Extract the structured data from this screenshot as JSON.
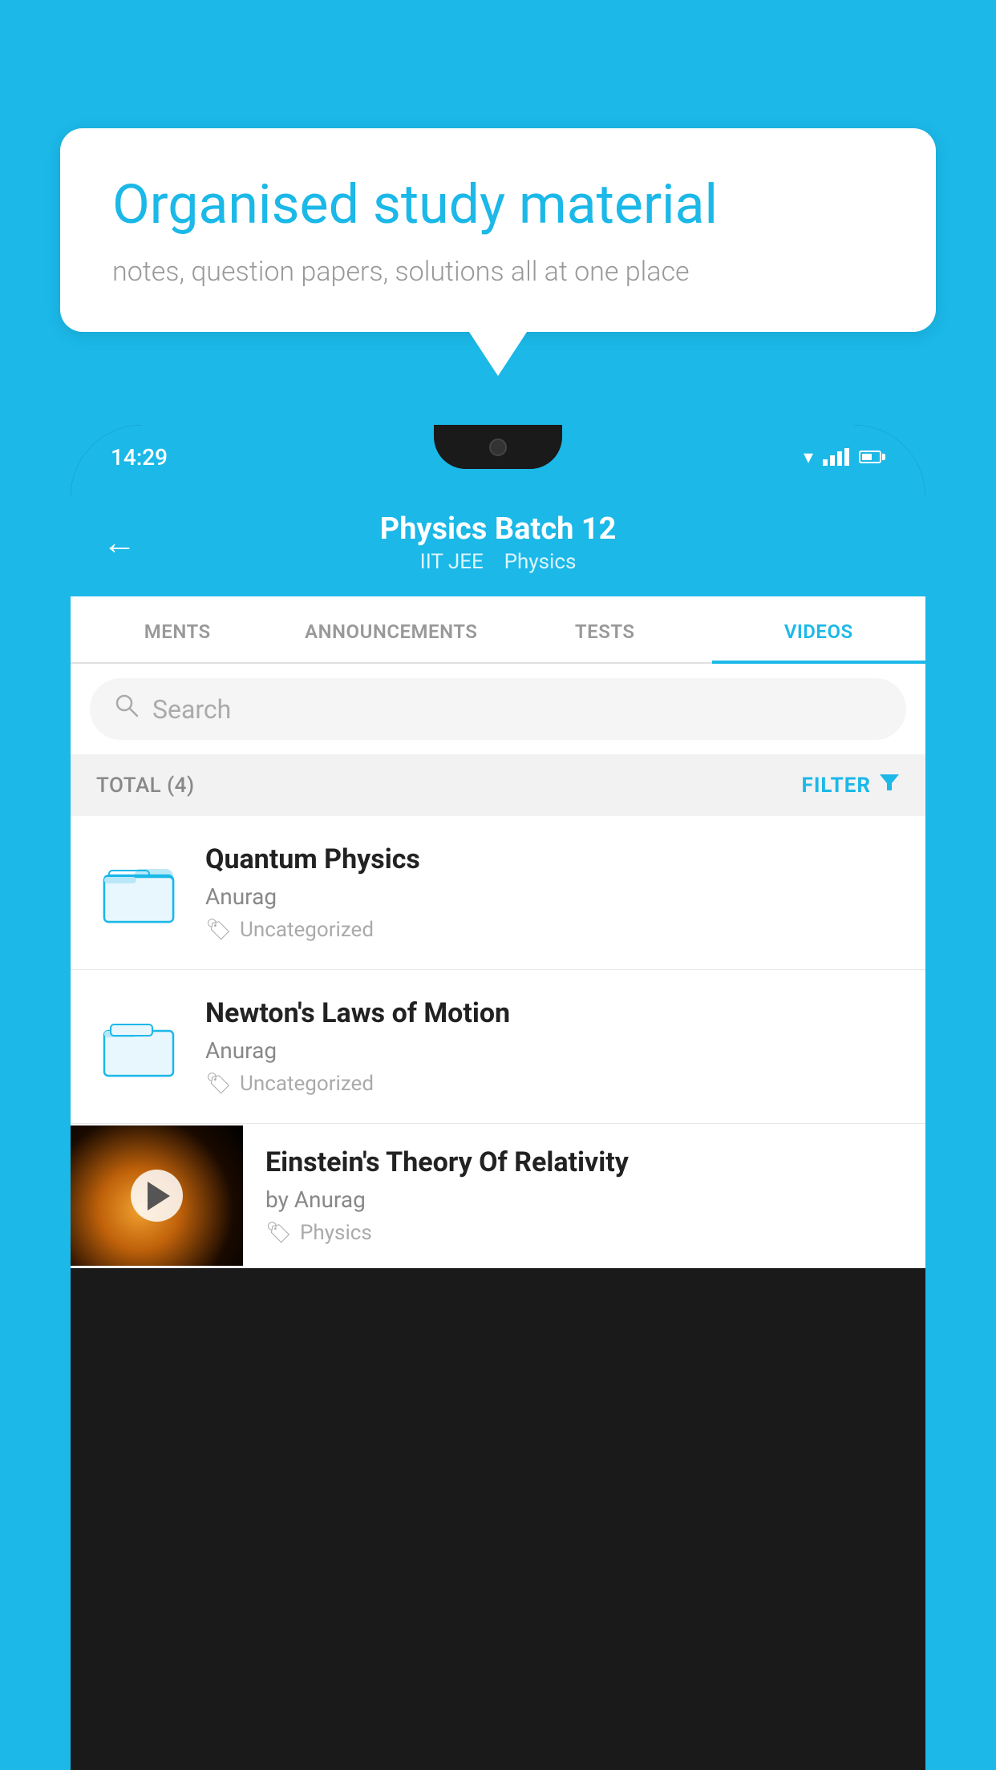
{
  "background_color": "#1BB8E8",
  "speech_bubble": {
    "title": "Organised study material",
    "subtitle": "notes, question papers, solutions all at one place"
  },
  "phone": {
    "status_bar": {
      "time": "14:29"
    },
    "header": {
      "title": "Physics Batch 12",
      "subtitle_part1": "IIT JEE",
      "subtitle_part2": "Physics",
      "back_label": "←"
    },
    "tabs": [
      {
        "label": "MENTS",
        "active": false
      },
      {
        "label": "ANNOUNCEMENTS",
        "active": false
      },
      {
        "label": "TESTS",
        "active": false
      },
      {
        "label": "VIDEOS",
        "active": true
      }
    ],
    "search": {
      "placeholder": "Search"
    },
    "filter_row": {
      "total_label": "TOTAL (4)",
      "filter_label": "FILTER"
    },
    "videos": [
      {
        "id": 1,
        "title": "Quantum Physics",
        "author": "Anurag",
        "tag": "Uncategorized",
        "type": "folder"
      },
      {
        "id": 2,
        "title": "Newton's Laws of Motion",
        "author": "Anurag",
        "tag": "Uncategorized",
        "type": "folder"
      },
      {
        "id": 3,
        "title": "Einstein's Theory Of Relativity",
        "author": "by Anurag",
        "tag": "Physics",
        "type": "video"
      }
    ]
  }
}
